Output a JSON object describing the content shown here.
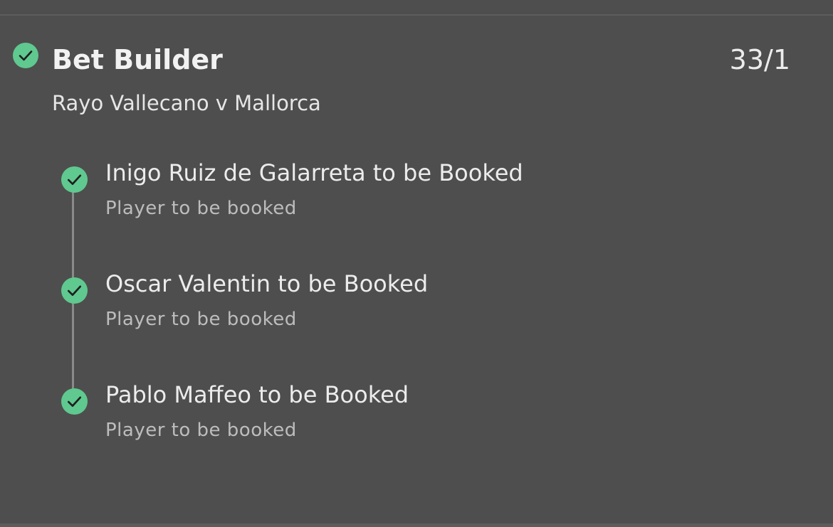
{
  "colors": {
    "background": "#4e4e4e",
    "success_check": "#5fc98f",
    "check_mark": "#1f1f1f",
    "timeline": "#8a8a8a",
    "primary_text": "#f2f2f2",
    "secondary_text": "#bdbdbd"
  },
  "bet": {
    "status_icon": "check-circle-icon",
    "title": "Bet Builder",
    "odds": "33/1",
    "event": "Rayo Vallecano v Mallorca",
    "legs": [
      {
        "status_icon": "check-circle-icon",
        "selection": "Inigo Ruiz de Galarreta to be Booked",
        "market": "Player to be booked"
      },
      {
        "status_icon": "check-circle-icon",
        "selection": "Oscar Valentin to be Booked",
        "market": "Player to be booked"
      },
      {
        "status_icon": "check-circle-icon",
        "selection": "Pablo Maffeo to be Booked",
        "market": "Player to be booked"
      }
    ]
  }
}
